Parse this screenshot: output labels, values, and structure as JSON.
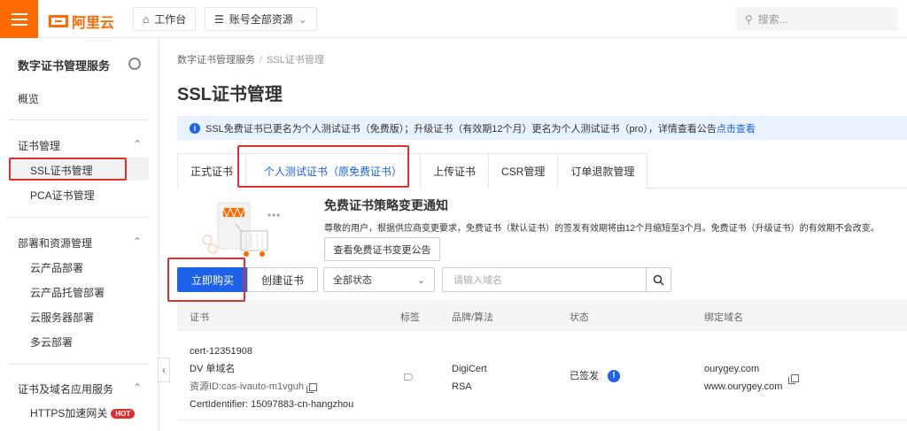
{
  "topbar": {
    "logo_text": "阿里云",
    "workbench_label": "工作台",
    "resources_label": "账号全部资源",
    "search_placeholder": "搜索..."
  },
  "sidebar": {
    "title": "数字证书管理服务",
    "overview": "概览",
    "groups": [
      {
        "label": "证书管理",
        "items": [
          "SSL证书管理",
          "PCA证书管理"
        ]
      },
      {
        "label": "部署和资源管理",
        "items": [
          "云产品部署",
          "云产品托管部署",
          "云服务器部署",
          "多云部署"
        ]
      },
      {
        "label": "证书及域名应用服务",
        "items": [
          "HTTPS加速网关"
        ]
      }
    ],
    "hot_badge": "HOT"
  },
  "breadcrumb": {
    "root": "数字证书管理服务",
    "current": "SSL证书管理"
  },
  "page_title": "SSL证书管理",
  "notice": {
    "text": "SSL免费证书已更名为个人测试证书（免费版）；升级证书（有效期12个月）更名为个人测试证书（pro），详情查看公告",
    "link": "点击查看"
  },
  "tabs": [
    "正式证书",
    "个人测试证书（原免费证书）",
    "上传证书",
    "CSR管理",
    "订单退款管理"
  ],
  "promo": {
    "title": "免费证书策略变更通知",
    "text": "尊敬的用户，根据供应商变更要求，免费证书（默认证书）的签发有效期将由12个月缩短至3个月。免费证书（升级证书）的有效期不会改变。",
    "button": "查看免费证书变更公告"
  },
  "toolbar": {
    "buy_label": "立即购买",
    "create_label": "创建证书",
    "status_select": "全部状态",
    "domain_placeholder": "请输入域名"
  },
  "table": {
    "headers": [
      "证书",
      "标签",
      "品牌/算法",
      "状态",
      "绑定域名"
    ],
    "rows": [
      {
        "cert_name": "cert-12351908",
        "cert_type": "DV 单域名",
        "resource_id": "资源ID:cas-ivauto-m1vguh",
        "identifier": "CertIdentifier: 15097883-cn-hangzhou",
        "brand": "DigiCert",
        "algorithm": "RSA",
        "status": "已签发",
        "domain1": "ourygey.com",
        "domain2": "www.ourygey.com"
      }
    ]
  },
  "colors": {
    "brand": "#ff6a00",
    "accent": "#1e62ec",
    "highlight": "#e02e2e"
  }
}
